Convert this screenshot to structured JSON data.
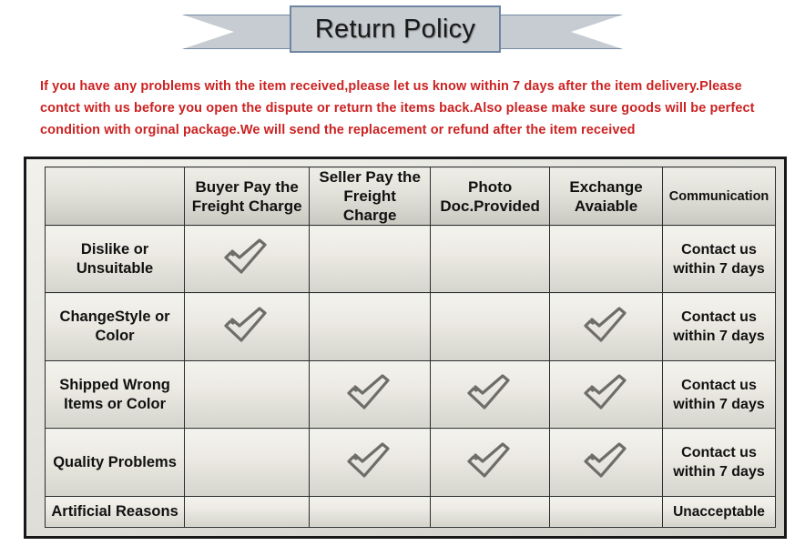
{
  "banner": {
    "title": "Return Policy",
    "fill_color": "#c7ccd1",
    "border_color": "#6f86a3"
  },
  "policy": {
    "text_color": "#cc2222",
    "text": "If you  have any problems with the item received,please let us know within 7 days after the item delivery.Please contct with us before you open the dispute or return the items back.Also please make sure goods will be perfect condition with orginal package.We will send the replacement or refund after the item received"
  },
  "table": {
    "headers": [
      "",
      "Buyer Pay the Freight Charge",
      "Seller Pay the Freight Charge",
      "Photo Doc.Provided",
      "Exchange Avaiable",
      "Communication"
    ],
    "check_icon": "check-mark-icon",
    "check_color": "#6e6e68",
    "rows": [
      {
        "reason": "Dislike or Unsuitable",
        "buyer_pay": "check",
        "seller_pay": "",
        "photo_doc": "",
        "exchange": "",
        "communication": "Contact us within 7 days"
      },
      {
        "reason": "ChangeStyle or Color",
        "buyer_pay": "check",
        "seller_pay": "",
        "photo_doc": "",
        "exchange": "check",
        "communication": "Contact us within 7 days"
      },
      {
        "reason": "Shipped Wrong Items or Color",
        "buyer_pay": "",
        "seller_pay": "check",
        "photo_doc": "check",
        "exchange": "check",
        "communication": "Contact us within 7 days"
      },
      {
        "reason": "Quality Problems",
        "buyer_pay": "",
        "seller_pay": "check",
        "photo_doc": "check",
        "exchange": "check",
        "communication": "Contact us within 7 days"
      },
      {
        "reason": "Artificial Reasons",
        "buyer_pay": "",
        "seller_pay": "",
        "photo_doc": "",
        "exchange": "",
        "communication": "Unacceptable"
      }
    ]
  }
}
